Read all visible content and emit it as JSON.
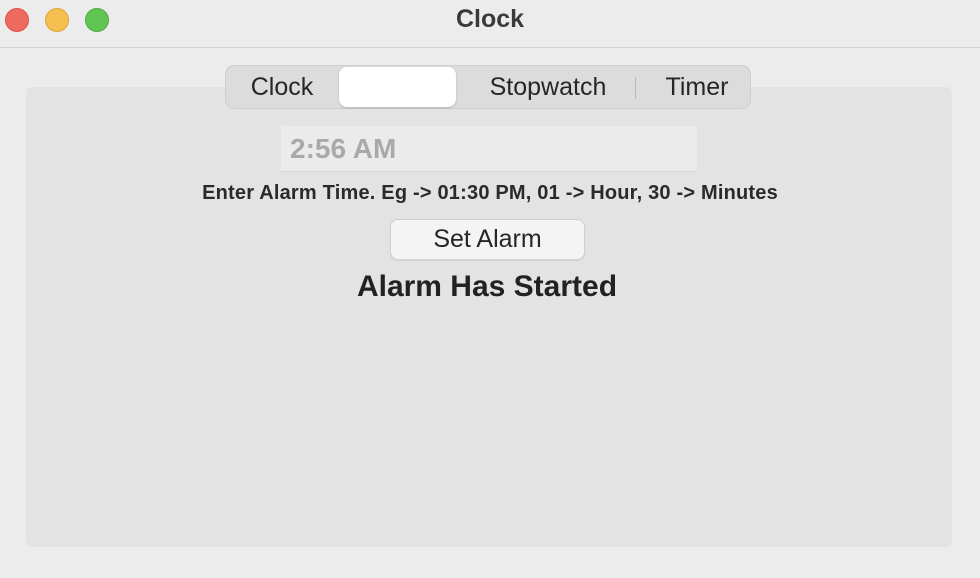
{
  "window": {
    "title": "Clock",
    "traffic_lights": {
      "close_color": "#ee6a5e",
      "minimize_color": "#f5bf4f",
      "maximize_color": "#61c554"
    }
  },
  "tabs": {
    "items": [
      {
        "label": "Clock",
        "selected": false
      },
      {
        "label": "",
        "selected": true
      },
      {
        "label": "Stopwatch",
        "selected": false
      },
      {
        "label": "Timer",
        "selected": false
      }
    ]
  },
  "alarm": {
    "time_input": {
      "placeholder": "2:56 AM",
      "value": ""
    },
    "hint": "Enter Alarm Time. Eg -> 01:30 PM, 01 -> Hour, 30 -> Minutes",
    "set_button_label": "Set Alarm",
    "status": "Alarm Has Started"
  }
}
